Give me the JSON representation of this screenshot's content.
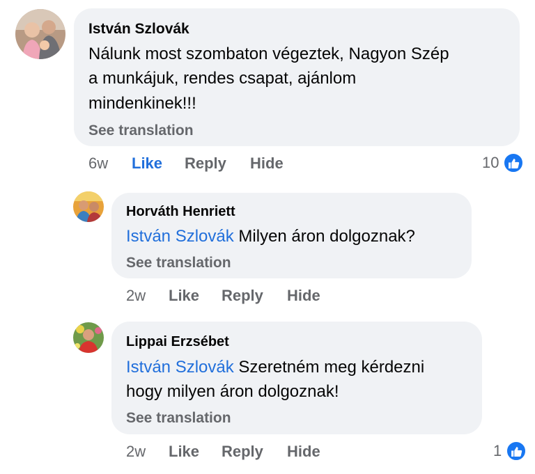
{
  "comments": [
    {
      "author": "István Szlovák",
      "text_lines": [
        "Nálunk most szombaton végeztek, Nagyon Szép",
        "a munkájuk, rendes csapat, ajánlom",
        "mindenkinek!!!"
      ],
      "see_translation": "See translation",
      "time": "6w",
      "like_label": "Like",
      "reply_label": "Reply",
      "hide_label": "Hide",
      "reaction_count": "10",
      "reaction_icon": "thumbs-up-icon",
      "like_active": true
    },
    {
      "author": "Horváth Henriett",
      "mention": "István Szlovák",
      "text_lines": [
        "Milyen áron dolgoznak?"
      ],
      "see_translation": "See translation",
      "time": "2w",
      "like_label": "Like",
      "reply_label": "Reply",
      "hide_label": "Hide"
    },
    {
      "author": "Lippai Erzsébet",
      "mention": "István Szlovák",
      "text_lines": [
        "Szeretném meg kérdezni",
        "hogy milyen áron dolgoznak!"
      ],
      "see_translation": "See translation",
      "time": "2w",
      "like_label": "Like",
      "reply_label": "Reply",
      "hide_label": "Hide",
      "reaction_count": "1",
      "reaction_icon": "thumbs-up-icon"
    }
  ],
  "colors": {
    "bubble": "#f0f2f5",
    "mention": "#216fdb",
    "like_active": "#216fdb",
    "secondary_text": "#65676b",
    "reaction_badge": "#1877f2"
  }
}
